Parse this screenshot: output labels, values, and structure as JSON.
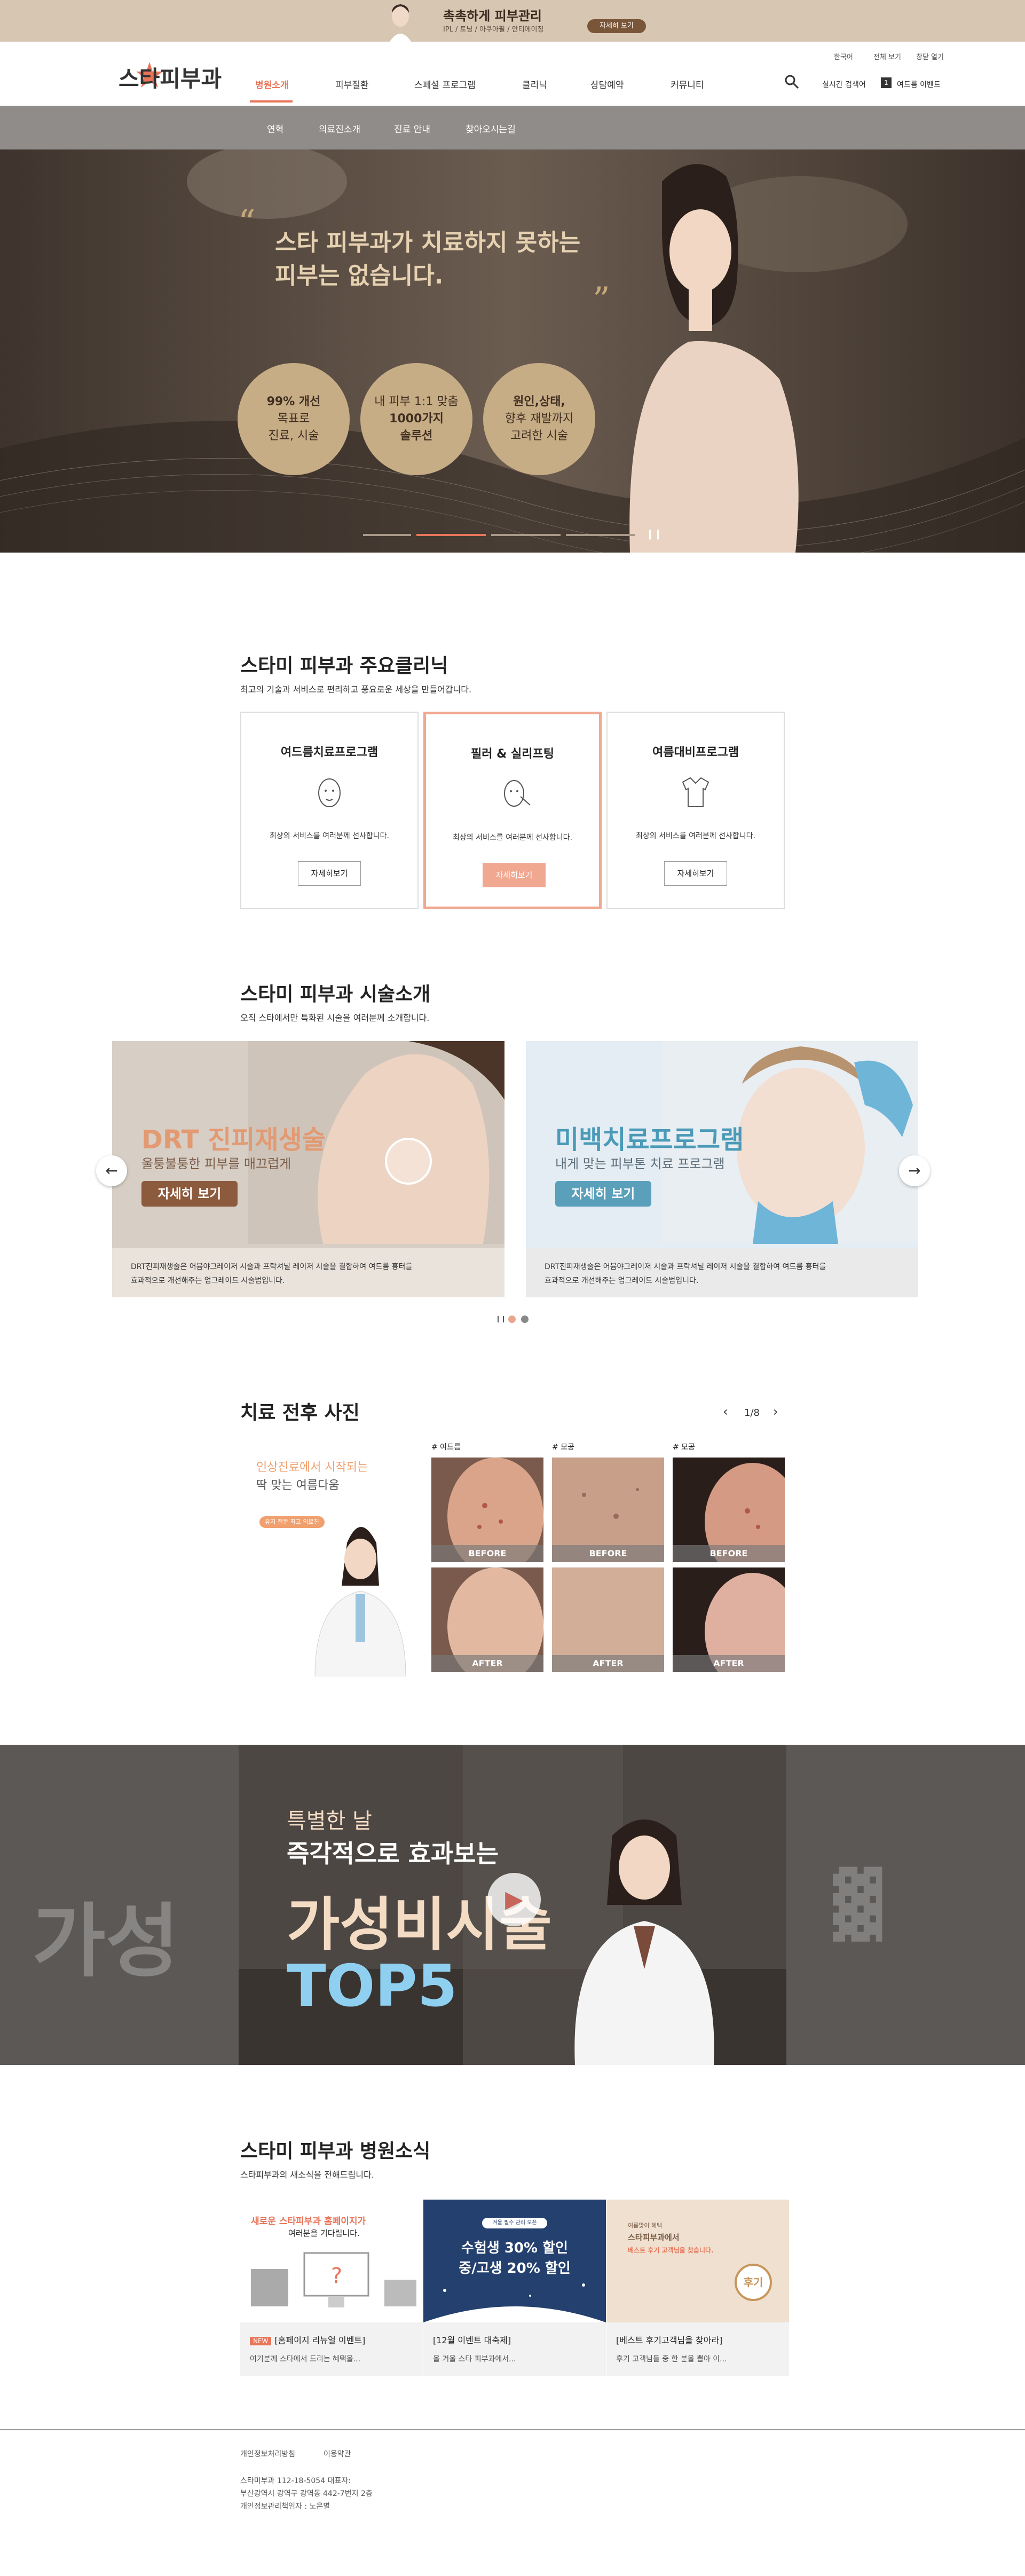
{
  "top_banner": {
    "title": "촉촉하게 피부관리",
    "subtitle": "IPL / 토닝 / 아쿠아필 / 안티에이징",
    "button_label": "자세히 보기"
  },
  "utility_links": [
    "한국어",
    "전체 보기",
    "창닫 열기"
  ],
  "logo_text": "스타피부과",
  "nav": [
    "병원소개",
    "피부질환",
    "스페셜 프로그램",
    "클리닉",
    "상담예약",
    "커뮤니티"
  ],
  "header_links": [
    "실시간 검색어",
    "여드름 이벤트"
  ],
  "header_badge": "1",
  "subnav": [
    "연혁",
    "의료진소개",
    "진료 안내",
    "찾아오시는길"
  ],
  "hero": {
    "line1": "스타 피부과가 치료하지 못하는",
    "line2": "피부는 없습니다.",
    "circles": [
      {
        "l1": "99% 개선",
        "l2": "목표로",
        "l3": "진료, 시술"
      },
      {
        "l1": "내 피부 1:1 맞춤",
        "l2": "1000가지",
        "l3": "솔루션"
      },
      {
        "l1": "원인,상태,",
        "l2": "향후 재발까지",
        "l3": "고려한 시술"
      }
    ]
  },
  "clinics": {
    "title": "스타미 피부과 주요클리닉",
    "desc": "최고의 기술과 서비스로 편리하고 풍요로운 세상을 만들어갑니다.",
    "cards": [
      {
        "title": "여드름치료프로그램",
        "desc": "최상의 서비스를 여러분께 선사합니다.",
        "button": "자세히보기",
        "icon": "face-acne-icon"
      },
      {
        "title": "필러 & 실리프팅",
        "desc": "최상의 서비스를 여러분께 선사합니다.",
        "button": "자세히보기",
        "icon": "face-lifting-icon"
      },
      {
        "title": "여름대비프로그램",
        "desc": "최상의 서비스를 여러분께 선사합니다.",
        "button": "자세히보기",
        "icon": "shirt-icon"
      }
    ]
  },
  "treatments": {
    "title": "스타미 피부과 시술소개",
    "desc": "오직 스타에서만 특화된 시술을 여러분께 소개합니다.",
    "cards": [
      {
        "title": "DRT 진피재생술",
        "subtitle": "울퉁불퉁한 피부를 매끄럽게",
        "button": "자세히 보기",
        "desc_line1": "DRT진피재생술은 어븀야그레이저 시술과 프락셔널 레이저 시술을 결합하여 여드름 흉터를",
        "desc_line2": "효과적으로 개선해주는 업그레이드 시술법입니다."
      },
      {
        "title": "미백치료프로그램",
        "subtitle": "내게 맞는 피부톤 치료 프로그램",
        "button": "자세히 보기",
        "desc_line1": "DRT진피재생술은 어븀야그레이저 시술과 프락셔널 레이저 시술을 결합하여 여드름 흉터를",
        "desc_line2": "효과적으로 개선해주는 업그레이드 시술법입니다."
      }
    ]
  },
  "before_after": {
    "title": "치료 전후 사진",
    "page": "1/8",
    "promo_line1": "인상진료에서 시작되는",
    "promo_line2": "딱 맞는 여름다움",
    "promo_tag": "유지 전문 최고 의료진",
    "tags": [
      "# 여드름",
      "# 모공",
      "# 모공"
    ],
    "before_label": "BEFORE",
    "after_label": "AFTER"
  },
  "video": {
    "line1": "특별한 날",
    "line2": "즉각적으로 효과보는",
    "line3": "가성비시술",
    "line4": "TOP5"
  },
  "news": {
    "title": "스타미 피부과 병원소식",
    "desc": "스타피부과의 새소식을 전해드립니다.",
    "cards": [
      {
        "img_line1": "새로운 스타피부과 홈페이지가",
        "img_line2": "여러분을 기다립니다.",
        "tag": "NEW",
        "title": "[홈페이지 리뉴얼 이벤트]",
        "desc": "여기분께 스타에서 드리는 혜택을..."
      },
      {
        "img_line0": "겨울 필수 관리 오픈",
        "img_line1": "수험생 30% 할인",
        "img_line2": "중/고생 20% 할인",
        "title": "[12월 이벤트 대축제]",
        "desc": "올 겨울 스타 피부과에서..."
      },
      {
        "img_line0": "여름맞이 혜택",
        "img_line1": "스타피부과에서",
        "img_line2": "베스트 후기 고객님을 찾습니다.",
        "img_badge": "후기",
        "title": "[베스트 후기고객님을 찾아라]",
        "desc": "후기 고객님들 중 한 분을 뽑아 이..."
      }
    ]
  },
  "footer": {
    "links": [
      "개인정보처리방침",
      "이용약관"
    ],
    "lines": [
      "스타미부과 112-18-5054 대표자:",
      "부산광역시 광역구 광역동 442-7번지 2층",
      "개인정보관리책임자 : 노은별"
    ]
  },
  "colors": {
    "accent": "#e8755a",
    "card_active": "#f0a891",
    "hero_gold": "#c7ad86"
  }
}
